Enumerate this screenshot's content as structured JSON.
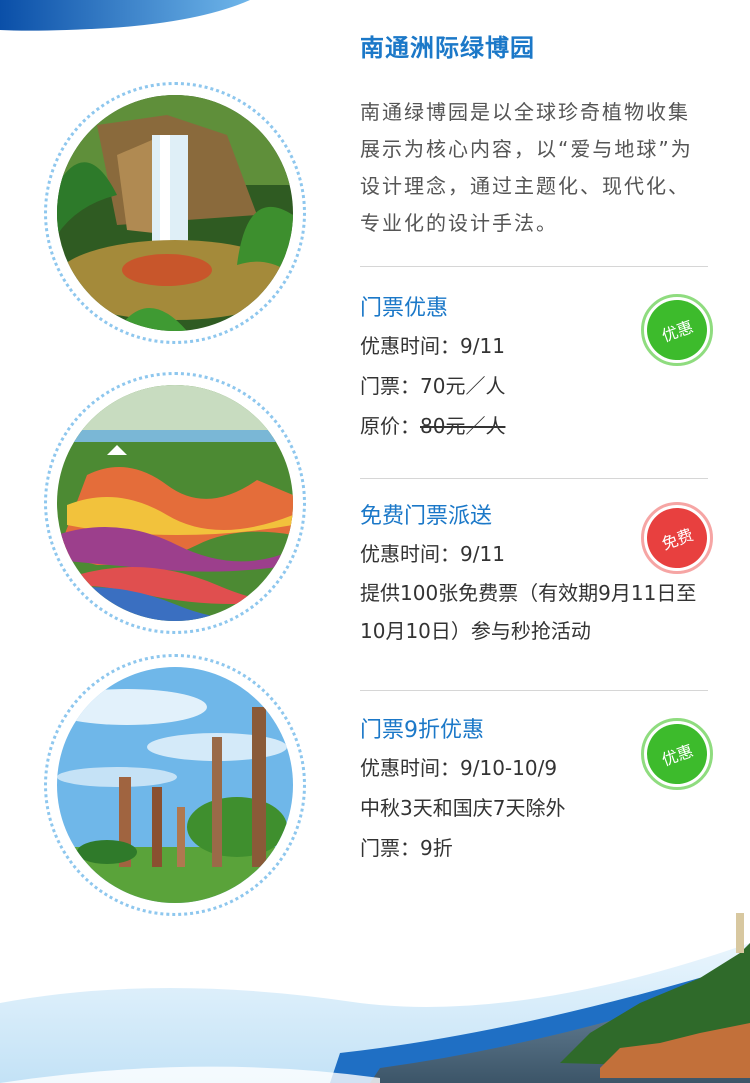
{
  "title": "南通洲际绿博园",
  "intro": "南通绿博园是以全球珍奇植物收集展示为核心内容，以“爱与地球”为设计理念，通过主题化、现代化、专业化的设计手法。",
  "photos": [
    {
      "name": "waterfall-garden-photo",
      "colors": {
        "bg": "#2f5b22",
        "water": "#cfe8f3"
      }
    },
    {
      "name": "flower-field-photo",
      "colors": {
        "bg": "#4c8a33"
      }
    },
    {
      "name": "totem-park-photo",
      "colors": {
        "bg": "#6fb7e9"
      }
    }
  ],
  "sections": [
    {
      "title": "门票优惠",
      "badge": {
        "label": "优惠",
        "color": "#3dbb2c",
        "ring": "#8fdc7f"
      },
      "lines": [
        {
          "label": "优惠时间：",
          "value": "9/11"
        },
        {
          "label": "门票：",
          "value": "70元／人"
        },
        {
          "label": "原价：",
          "value": "80元／人",
          "strike": true
        }
      ]
    },
    {
      "title": "免费门票派送",
      "badge": {
        "label": "免费",
        "color": "#e8403f",
        "ring": "#f6a5a4"
      },
      "lines": [
        {
          "label": "优惠时间：",
          "value": "9/11"
        },
        {
          "label": "",
          "value": "提供100张免费票（有效期9月11日至10月10日）参与秒抢活动"
        }
      ]
    },
    {
      "title": "门票9折优惠",
      "badge": {
        "label": "优惠",
        "color": "#3dbb2c",
        "ring": "#8fdc7f"
      },
      "lines": [
        {
          "label": "优惠时间：",
          "value": "9/10-10/9"
        },
        {
          "label": "",
          "value": "中秋3天和国庆7天除外"
        },
        {
          "label": "门票：",
          "value": "9折"
        }
      ]
    }
  ]
}
